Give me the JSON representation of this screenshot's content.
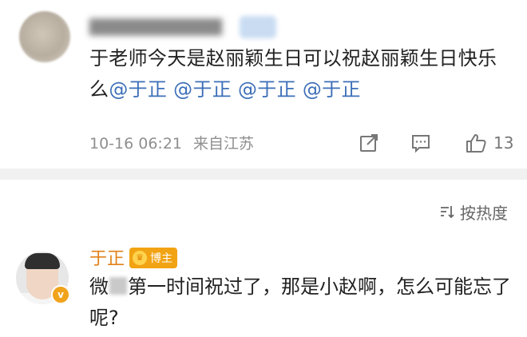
{
  "post": {
    "text_before": "于老师今天是赵丽颖生日可以祝赵丽颖生日快乐么",
    "mentions": [
      "@于正",
      "@于正",
      "@于正",
      "@于正"
    ],
    "timestamp": "10-16 06:21",
    "location": "来自江苏",
    "like_count": "13"
  },
  "sort": {
    "label": "按热度"
  },
  "reply": {
    "name": "于正",
    "badge": "博主",
    "text_start": "微",
    "text_rest": "第一时间祝过了，那是小赵啊，怎么可能忘了呢?"
  },
  "colors": {
    "mention": "#3d6fb8",
    "name_orange": "#e0821a",
    "badge_orange": "#f2a313",
    "meta_gray": "#8f8f8f"
  }
}
